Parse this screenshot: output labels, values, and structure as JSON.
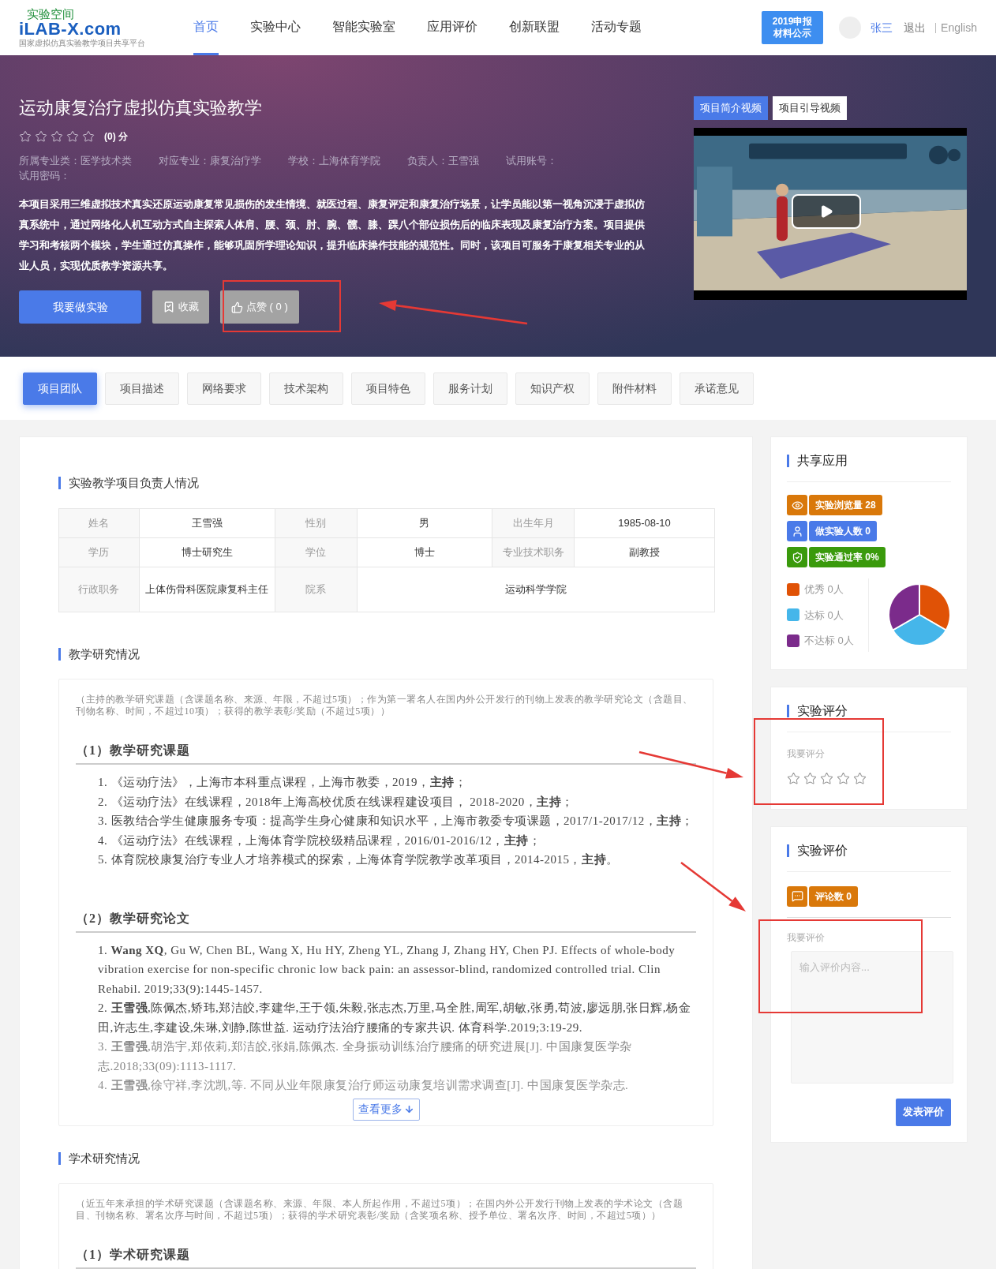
{
  "header": {
    "logo": {
      "top": "实验空间",
      "main": "iLAB-X.com",
      "subtitle": "国家虚拟仿真实验教学项目共享平台"
    },
    "nav": [
      {
        "label": "首页",
        "selected": true
      },
      {
        "label": "实验中心",
        "selected": false
      },
      {
        "label": "智能实验室",
        "selected": false
      },
      {
        "label": "应用评价",
        "selected": false
      },
      {
        "label": "创新联盟",
        "selected": false
      },
      {
        "label": "活动专题",
        "selected": false
      }
    ],
    "badge": [
      "2019申报",
      "材料公示"
    ],
    "user": "张三",
    "links": [
      "退出",
      "English"
    ]
  },
  "hero": {
    "title": "运动康复治疗虚拟仿真实验教学",
    "rating": {
      "stars": 0,
      "score": "(0) 分"
    },
    "info": [
      "所属专业类：医学技术类",
      "对应专业：康复治疗学",
      "学校：上海体育学院",
      "负责人：王雪强",
      "试用账号：",
      "试用密码："
    ],
    "description": "本项目采用三维虚拟技术真实还原运动康复常见损伤的发生情境、就医过程、康复评定和康复治疗场景，让学员能以第一视角沉浸于虚拟仿真系统中，通过网络化人机互动方式自主探索人体肩、腰、颈、肘、腕、髋、膝、踝八个部位损伤后的临床表现及康复治疗方案。项目提供学习和考核两个模块，学生通过仿真操作，能够巩固所学理论知识，提升临床操作技能的规范性。同时，该项目可服务于康复相关专业的从业人员，实现优质教学资源共享。",
    "buttons": [
      {
        "kind": "primary",
        "label": "我要做实验"
      },
      {
        "kind": "collect",
        "label": "收藏"
      },
      {
        "kind": "like",
        "label": "点赞 ( 0 )"
      }
    ],
    "video_tabs": [
      {
        "label": "项目简介视频",
        "selected": true
      },
      {
        "label": "项目引导视频",
        "selected": false
      }
    ]
  },
  "tabs": [
    {
      "label": "项目团队",
      "selected": true
    },
    {
      "label": "项目描述",
      "selected": false
    },
    {
      "label": "网络要求",
      "selected": false
    },
    {
      "label": "技术架构",
      "selected": false
    },
    {
      "label": "项目特色",
      "selected": false
    },
    {
      "label": "服务计划",
      "selected": false
    },
    {
      "label": "知识产权",
      "selected": false
    },
    {
      "label": "附件材料",
      "selected": false
    },
    {
      "label": "承诺意见",
      "selected": false
    }
  ],
  "leader": {
    "heading": "实验教学项目负责人情况",
    "rows": [
      [
        {
          "kind": "label",
          "text": "姓名"
        },
        {
          "kind": "value",
          "text": "王雪强"
        },
        {
          "kind": "label",
          "text": "性别"
        },
        {
          "kind": "value",
          "text": "男"
        },
        {
          "kind": "label",
          "text": "出生年月"
        },
        {
          "kind": "value",
          "text": "1985-08-10"
        }
      ],
      [
        {
          "kind": "label",
          "text": "学历"
        },
        {
          "kind": "value",
          "text": "博士研究生"
        },
        {
          "kind": "label",
          "text": "学位"
        },
        {
          "kind": "value",
          "text": "博士"
        },
        {
          "kind": "label",
          "text": "专业技术职务"
        },
        {
          "kind": "value",
          "text": "副教授"
        }
      ],
      [
        {
          "kind": "label",
          "text": "行政职务"
        },
        {
          "kind": "value",
          "text": "上体伤骨科医院康复科主任"
        },
        {
          "kind": "label",
          "text": "院系"
        },
        {
          "kind": "value",
          "text": "运动科学学院",
          "colspan": 3
        }
      ]
    ]
  },
  "teaching": {
    "heading": "教学研究情况",
    "note": "（主持的教学研究课题（含课题名称、来源、年限，不超过5项）；作为第一署名人在国内外公开发行的刊物上发表的教学研究论文（含题目、刊物名称、时间，不超过10项）；获得的教学表彰/奖励（不超过5项））",
    "sections": [
      {
        "title": "（1）教学研究课题",
        "items": [
          "1.  《运动疗法》，上海市本科重点课程，上海市教委，2019，**主持**；",
          "2.  《运动疗法》在线课程，2018年上海高校优质在线课程建设项目， 2018-2020，**主持**；",
          "3.  医教结合学生健康服务专项：提高学生身心健康和知识水平，上海市教委专项课题，2017/1-2017/12，**主持**；",
          "4.  《运动疗法》在线课程，上海体育学院校级精品课程，2016/01-2016/12，**主持**；",
          "5.  体育院校康复治疗专业人才培养模式的探索，上海体育学院教学改革项目，2014-2015，**主持**。"
        ]
      },
      {
        "title": "（2）教学研究论文",
        "items": [
          "1.  **Wang XQ**, Gu W, Chen BL, Wang X, Hu HY, Zheng YL, Zhang J, Zhang HY, Chen PJ. Effects of whole-body vibration exercise for non-specific chronic low back pain: an assessor-blind, randomized controlled trial. Clin Rehabil. 2019;33(9):1445-1457.",
          "2.  **王雪强**,陈佩杰,矫玮,郑洁皎,李建华,王于领,朱毅,张志杰,万里,马全胜,周军,胡敏,张勇,苟波,廖远朋,张日辉,杨金田,许志生,李建设,朱琳,刘静,陈世益. 运动疗法治疗腰痛的专家共识. 体育科学.2019;3:19-29.",
          "3.  **王雪强**,胡浩宇,郑依莉,郑洁皎,张娟,陈佩杰. 全身振动训练治疗腰痛的研究进展[J]. 中国康复医学杂志.2018;33(09):1113-1117.",
          "4.  **王雪强**,徐守祥,李沈凯,等. 不同从业年限康复治疗师运动康复培训需求调查[J]. 中国康复医学杂志."
        ]
      }
    ],
    "more_button": "查看更多"
  },
  "academic": {
    "heading": "学术研究情况",
    "note": "（近五年来承担的学术研究课题（含课题名称、来源、年限、本人所起作用，不超过5项）；在国内外公开发行刊物上发表的学术论文（含题目、刊物名称、署名次序与时间，不超过5项）；获得的学术研究表彰/奖励（含奖项名称、授予单位、署名次序、时间，不超过5项））",
    "sections": [
      {
        "title": "（1）学术研究课题"
      }
    ]
  },
  "sidebar": {
    "share": {
      "title": "共享应用",
      "stats": [
        {
          "kind": "views",
          "label": "实验浏览量 28",
          "color": "#d9780a"
        },
        {
          "kind": "people",
          "label": "做实验人数 0",
          "color": "#4a7ae8"
        },
        {
          "kind": "pass",
          "label": "实验通过率 0%",
          "color": "#3a9a0c"
        }
      ],
      "legend": [
        {
          "label": "优秀 0人",
          "color": "#e05206"
        },
        {
          "label": "达标 0人",
          "color": "#45b6ea"
        },
        {
          "label": "不达标 0人",
          "color": "#7b2b8b"
        }
      ]
    },
    "rating": {
      "title": "实验评分",
      "label": "我要评分",
      "stars": 0
    },
    "review": {
      "title": "实验评价",
      "badge": {
        "label": "评论数 0",
        "color": "#d9780a"
      },
      "label": "我要评价",
      "placeholder": "输入评价内容...",
      "button": "发表评价"
    }
  }
}
